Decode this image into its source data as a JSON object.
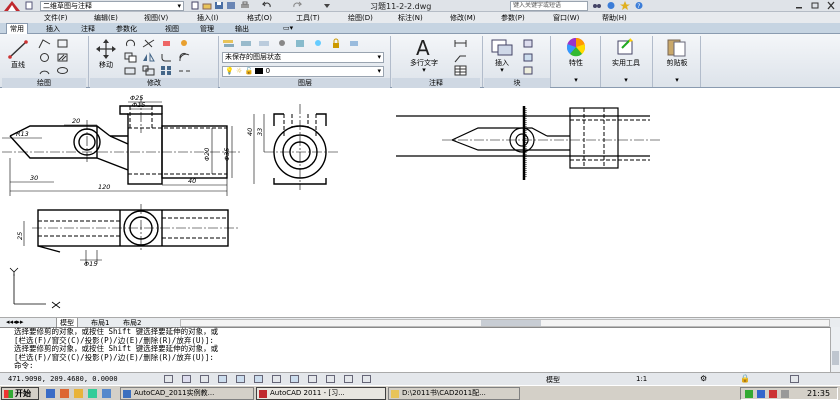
{
  "titlebar": {
    "workspace": "二维草图与注释",
    "document_title": "习题11-2-2.dwg",
    "search_placeholder": "键入关键字或短语"
  },
  "menu": [
    "文件(F)",
    "编辑(E)",
    "视图(V)",
    "插入(I)",
    "格式(O)",
    "工具(T)",
    "绘图(D)",
    "标注(N)",
    "修改(M)",
    "参数(P)",
    "窗口(W)",
    "帮助(H)"
  ],
  "ribbon_tabs": [
    "常用",
    "插入",
    "注释",
    "参数化",
    "视图",
    "管理",
    "输出"
  ],
  "ribbon": {
    "line_label": "直线",
    "move_label": "移动",
    "layer_state": "未保存的图层状态",
    "layer_current": "0",
    "mtext_label": "多行文字",
    "insert_label": "插入",
    "properties_label": "特性",
    "utilities_label": "实用工具",
    "clipboard_label": "剪贴板",
    "panels": [
      "绘图",
      "修改",
      "图层",
      "注释",
      "块"
    ]
  },
  "drawing": {
    "dims": [
      "Φ25",
      "Φ15",
      "20",
      "R13",
      "Φ20",
      "Φ35",
      "30",
      "120",
      "40",
      "40",
      "33",
      "25",
      "Φ15"
    ]
  },
  "layout_tabs": [
    "模型",
    "布局1",
    "布局2"
  ],
  "command_lines": [
    "选择要修剪的对象，或按住 Shift 键选择要延伸的对象，或",
    "[栏选(F)/窗交(C)/投影(P)/边(E)/删除(R)/放弃(U)]:",
    "选择要修剪的对象，或按住 Shift 键选择要延伸的对象，或",
    "[栏选(F)/窗交(C)/投影(P)/边(E)/删除(R)/放弃(U)]:",
    "命令:"
  ],
  "status": {
    "coords": "471.9090, 209.4680, 0.0000",
    "model_label": "模型",
    "scale": "1:1"
  },
  "taskbar": {
    "start": "开始",
    "tasks": [
      "AutoCAD_2011实例教...",
      "AutoCAD 2011 - [习...",
      "D:\\2011书\\CAD2011配..."
    ],
    "clock": "21:35"
  }
}
